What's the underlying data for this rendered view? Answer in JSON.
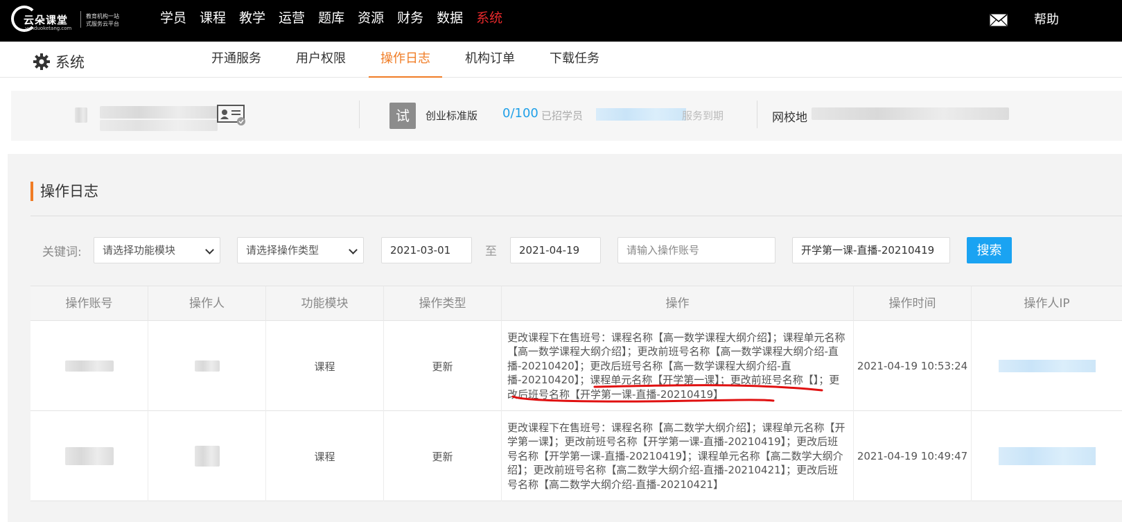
{
  "topbar": {
    "logo_text": "云朵课堂",
    "logo_sub": "yunduoketang.com",
    "logo_slogan_1": "教育机构一站",
    "logo_slogan_2": "式服务云平台",
    "nav": [
      "学员",
      "课程",
      "教学",
      "运营",
      "题库",
      "资源",
      "财务",
      "数据",
      "系统"
    ],
    "active_nav": "系统",
    "help_label": "帮助",
    "icon_mail": "mail-icon"
  },
  "subnav": {
    "title": "系统",
    "tabs": [
      "开通服务",
      "用户权限",
      "操作日志",
      "机构订单",
      "下载任务"
    ],
    "active_tab": "操作日志"
  },
  "info": {
    "trial_badge": "试",
    "edition": "创业标准版",
    "student_count": "0/100",
    "student_label": "已招学员",
    "expire_suffix": "服务到期",
    "school_label": "网校地"
  },
  "panel": {
    "title": "操作日志"
  },
  "filters": {
    "keyword_label": "关键词:",
    "module_placeholder": "请选择功能模块",
    "type_placeholder": "请选择操作类型",
    "date_from": "2021-03-01",
    "to_label": "至",
    "date_to": "2021-04-19",
    "account_placeholder": "请输入操作账号",
    "keyword_value": "开学第一课-直播-20210419",
    "search_label": "搜索"
  },
  "table": {
    "columns": [
      "操作账号",
      "操作人",
      "功能模块",
      "操作类型",
      "操作",
      "操作时间",
      "操作人IP"
    ],
    "rows": [
      {
        "module": "课程",
        "type": "更新",
        "operation": "更改课程下在售班号：课程名称【高一数学课程大纲介绍】；课程单元名称【高一数学课程大纲介绍】；更改前班号名称【高一数学课程大纲介绍-直播-20210420】；更改后班号名称【高一数学课程大纲介绍-直播-20210420】；课程单元名称【开学第一课】；更改前班号名称【】；更改后班号名称【开学第一课-直播-20210419】",
        "time": "2021-04-19 10:53:24"
      },
      {
        "module": "课程",
        "type": "更新",
        "operation": "更改课程下在售班号：课程名称【高二数学大纲介绍】；课程单元名称【开学第一课】；更改前班号名称【开学第一课-直播-20210419】；更改后班号名称【开学第一课-直播-20210419】；课程单元名称【高二数学大纲介绍】；更改前班号名称【高二数学大纲介绍-直播-20210421】；更改后班号名称【高二数学大纲介绍-直播-20210421】",
        "time": "2021-04-19 10:49:47"
      }
    ]
  }
}
